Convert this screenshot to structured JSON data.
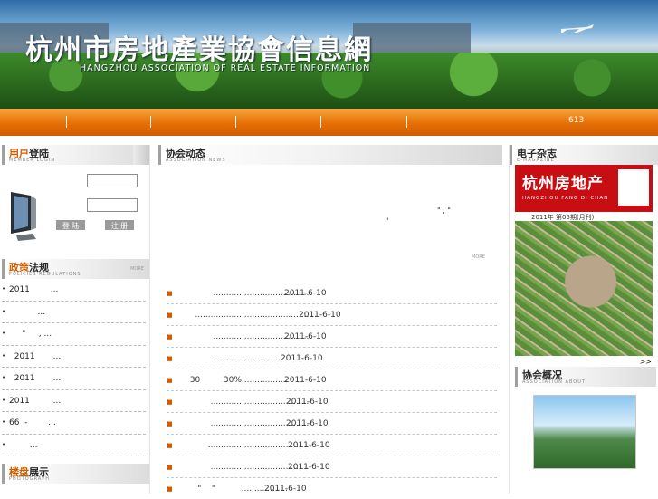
{
  "header": {
    "title": "杭州市房地產業協會信息網",
    "subtitle": "HANGZHOU ASSOCIATION OF REAL ESTATE INFORMATION"
  },
  "nav": {
    "separators": [
      "|",
      "|",
      "|",
      "|",
      "|"
    ],
    "right_text": "613"
  },
  "login": {
    "title_first": "用户",
    "title_rest": "登陆",
    "en": "MEMBER LOGIN",
    "username_placeholder": "",
    "password_placeholder": "",
    "login_label": "登 陆",
    "register_label": "注 册"
  },
  "policies": {
    "title_first": "政策",
    "title_rest": "法规",
    "en": "POLICIES REGULATIONS",
    "more": "MORE",
    "items": [
      "2011        ...",
      "           ...",
      "     \"     , ...",
      "  2011       ...",
      "  2011       ...",
      "2011         ...",
      "66  -        ...",
      "        ..."
    ]
  },
  "photo": {
    "title_first": "楼盘",
    "title_rest": "展示",
    "en": "PHOTOGRAPH"
  },
  "news": {
    "title": "协会动态",
    "en": "ASSOCIATION NEWS",
    "more": "MORE",
    "quote_marks": "\" , \"",
    "comma": "'",
    "items": [
      {
        "title": "           ......................................",
        "date": "2011-6-10"
      },
      {
        "title": "    ...............................................",
        "date": "2011-6-10"
      },
      {
        "title": "           ......................................",
        "date": "2011-6-10"
      },
      {
        "title": "            ..................................",
        "date": "2011-6-10"
      },
      {
        "title": "  30         30%..................",
        "date": "2011-6-10"
      },
      {
        "title": "          ......................................",
        "date": "2011-6-10"
      },
      {
        "title": "          ......................................",
        "date": "2011-6-10"
      },
      {
        "title": "         ........................................",
        "date": "2011-6-10"
      },
      {
        "title": "          ......................................",
        "date": "2011-6-10"
      },
      {
        "title": "     \"    \"          ..................",
        "date": "2011-6-10"
      }
    ]
  },
  "magazine": {
    "title": "电子杂志",
    "en": "E-MAGAZINE",
    "cover_name": "杭州房地产",
    "cover_pinyin": "HANGZHOU FANG DI CHAN",
    "issue": "2011年    第05期(月刊)",
    "more": ">>"
  },
  "about": {
    "title": "协会概况",
    "en": "ASSOCIATION ABOUT"
  }
}
